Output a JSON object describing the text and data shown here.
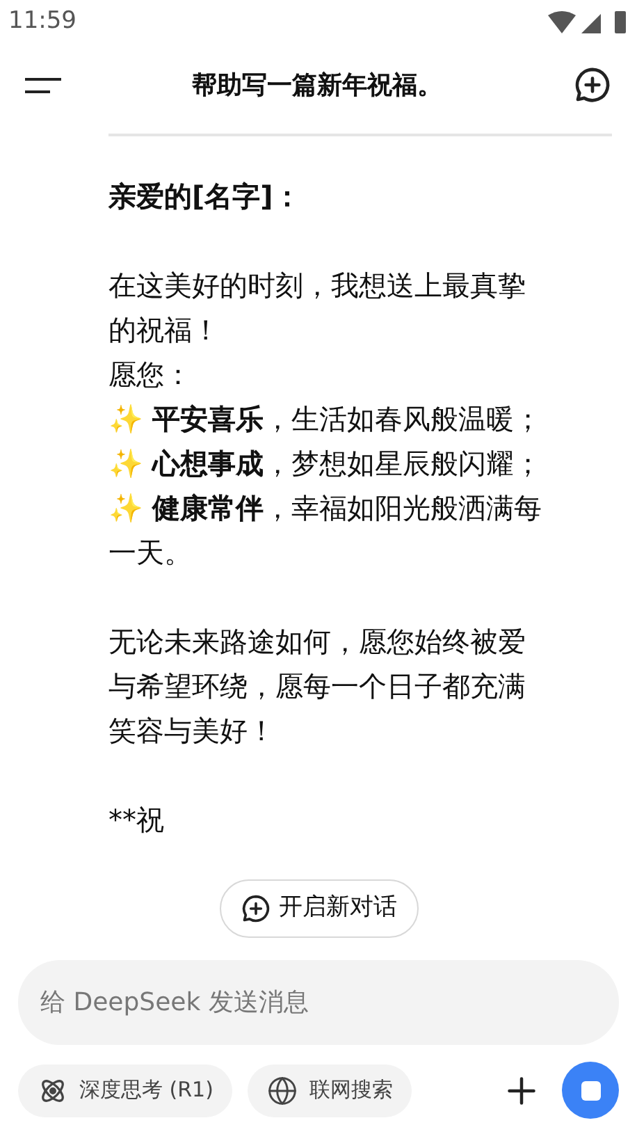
{
  "status_bar": {
    "time": "11:59"
  },
  "header": {
    "title": "帮助写一篇新年祝福。"
  },
  "message": {
    "paragraphs": [
      {
        "kind": "plain",
        "bold": true,
        "lines": [
          "亲爱的[名字]："
        ]
      },
      {
        "kind": "markdown",
        "bold": false,
        "lines": [
          "在这美好的时刻，我想送上最真挚",
          "的祝福！",
          "愿您：",
          "✨ **平安喜乐**，生活如春风般温暖；",
          "✨ **心想事成**，梦想如星辰般闪耀；",
          "✨ **健康常伴**，幸福如阳光般洒满每",
          "一天。"
        ]
      },
      {
        "kind": "plain",
        "bold": false,
        "lines": [
          "无论未来路途如何，愿您始终被爱",
          "与希望环绕，愿每一个日子都充满",
          "笑容与美好！"
        ]
      },
      {
        "kind": "plain",
        "bold": false,
        "lines": [
          "**祝"
        ]
      }
    ]
  },
  "new_chat_button": {
    "label": "开启新对话"
  },
  "composer": {
    "placeholder": "给 DeepSeek 发送消息",
    "options": [
      {
        "label": "深度思考 (R1)",
        "kind": "think",
        "selected": false
      },
      {
        "label": "联网搜索",
        "kind": "search",
        "selected": false
      }
    ]
  }
}
